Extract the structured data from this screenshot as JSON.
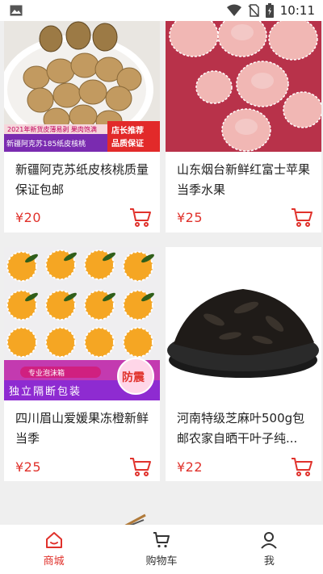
{
  "status_bar": {
    "time": "10:11"
  },
  "products": [
    {
      "title": "新疆阿克苏纸皮核桃质量保证包邮",
      "price": "¥20",
      "image": "walnut-image",
      "image_texts": {
        "banner": "2021年新货皮薄易剥 果肉饱满",
        "main": "新疆阿克苏185纸皮核桃",
        "tag1": "店长推荐",
        "tag2": "品质保证"
      }
    },
    {
      "title": "山东烟台新鲜红富士苹果当季水果",
      "price": "¥25",
      "image": "apple-image"
    },
    {
      "title": "四川眉山爱媛果冻橙新鲜当季",
      "price": "¥25",
      "image": "orange-image",
      "image_texts": {
        "badge": "专业泡沫箱",
        "main": "独立隔断包装",
        "tag": "防震"
      }
    },
    {
      "title": "河南特级芝麻叶500g包邮农家自晒干叶子纯...",
      "price": "¥22",
      "image": "dried-leaf-image"
    }
  ],
  "tabs": [
    {
      "label": "商城",
      "icon": "home-icon",
      "active": true
    },
    {
      "label": "购物车",
      "icon": "cart-icon",
      "active": false
    },
    {
      "label": "我",
      "icon": "user-icon",
      "active": false
    }
  ],
  "colors": {
    "accent": "#e0312b",
    "background": "#efefef"
  }
}
